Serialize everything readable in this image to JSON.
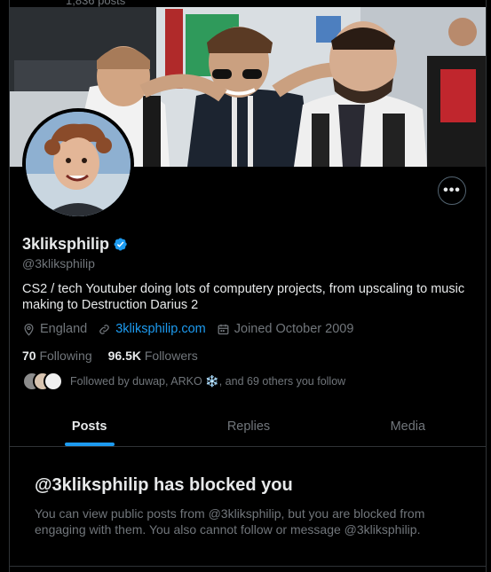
{
  "header": {
    "post_count": "1,836 posts"
  },
  "profile": {
    "display_name": "3kliksphilip",
    "handle": "@3kliksphilip",
    "bio": "CS2 / tech Youtuber doing lots of computery projects, from upscaling to music making to Destruction Darius 2",
    "location": "England",
    "website": "3kliksphilip.com",
    "joined": "Joined October 2009",
    "following_count": "70",
    "following_label": "Following",
    "followers_count": "96.5K",
    "followers_label": "Followers",
    "followed_by": "Followed by duwap, ARKO ❄️, and 69 others you follow",
    "more_button": "•••"
  },
  "icons": {
    "verified": "verified-badge-icon",
    "location": "location-pin-icon",
    "link": "link-icon",
    "calendar": "calendar-icon",
    "more": "more-dots-icon"
  },
  "tabs": [
    {
      "label": "Posts",
      "active": true
    },
    {
      "label": "Replies",
      "active": false
    },
    {
      "label": "Media",
      "active": false
    }
  ],
  "blocked": {
    "title": "@3kliksphilip has blocked you",
    "message": "You can view public posts from @3kliksphilip, but you are blocked from engaging with them. You also cannot follow or message @3kliksphilip."
  },
  "colors": {
    "accent": "#1d9bf0",
    "muted": "#71767b",
    "text": "#e7e9ea",
    "background": "#000000",
    "border": "#2f3336"
  }
}
